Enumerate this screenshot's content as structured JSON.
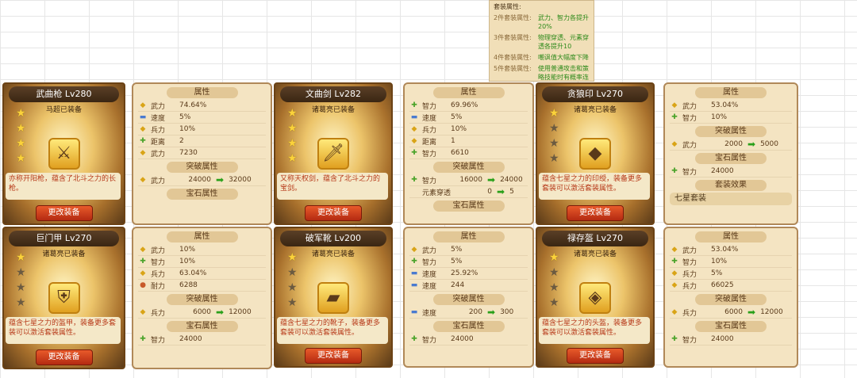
{
  "suit_info": {
    "title": "套装属性:",
    "rows": [
      {
        "key": "2件套装属性:",
        "value": "武力、智力各提升20%"
      },
      {
        "key": "3件套装属性:",
        "value": "物理穿透、元素穿透各提升10"
      },
      {
        "key": "4件套装属性:",
        "value": "嘲讽值大幅度下降"
      },
      {
        "key": "5件套装属性:",
        "value": "使用普通攻击和策略技能时有概率连击"
      }
    ]
  },
  "cards": [
    {
      "title": "武曲枪 Lv280",
      "sub": "马超已装备",
      "stars": [
        1,
        1,
        1,
        1
      ],
      "item_icon": "spear-icon",
      "item_glyph": "⚔",
      "desc": "亦称开阳枪，蕴含了北斗之力的长枪。",
      "button": "更改装备"
    },
    {
      "title": "文曲剑 Lv282",
      "sub": "诸葛亮已装备",
      "stars": [
        1,
        1,
        1,
        1
      ],
      "item_icon": "sword-icon",
      "item_glyph": "🗡",
      "desc": "又称天权剑，蕴含了北斗之力的宝剑。",
      "button": "更改装备"
    },
    {
      "title": "贪狼印 Lv270",
      "sub": "诸葛亮已装备",
      "stars": [
        1,
        0,
        0,
        0
      ],
      "item_icon": "seal-icon",
      "item_glyph": "◆",
      "desc": "蕴含七星之力的印绶，装备更多套装可以激活套装属性。",
      "button": "更改装备"
    },
    {
      "title": "巨门甲 Lv270",
      "sub": "诸葛亮已装备",
      "stars": [
        1,
        0,
        0,
        0
      ],
      "item_icon": "armor-icon",
      "item_glyph": "⛨",
      "desc": "蕴含七星之力的盔甲，装备更多套装可以激活套装属性。",
      "button": "更改装备"
    },
    {
      "title": "破军靴 Lv200",
      "sub": "诸葛亮已装备",
      "stars": [
        1,
        0,
        0,
        0
      ],
      "item_icon": "boots-icon",
      "item_glyph": "▰",
      "desc": "蕴含七星之力的靴子，装备更多套装可以激活套装属性。",
      "button": "更改装备"
    },
    {
      "title": "禄存盔 Lv270",
      "sub": "诸葛亮已装备",
      "stars": [
        1,
        0,
        0,
        0
      ],
      "item_icon": "helmet-icon",
      "item_glyph": "◈",
      "desc": "蕴含七星之力的头盔，装备更多套装可以激活套装属性。",
      "button": "更改装备"
    }
  ],
  "panels": [
    {
      "attr_title": "属性",
      "attrs": [
        {
          "icon": "g",
          "name": "武力",
          "value": "74.64%"
        },
        {
          "icon": "b",
          "name": "速度",
          "value": "5%"
        },
        {
          "icon": "g",
          "name": "兵力",
          "value": "10%"
        },
        {
          "icon": "gr",
          "name": "距离",
          "value": "2"
        },
        {
          "icon": "g",
          "name": "武力",
          "value": "7230"
        }
      ],
      "break_title": "突破属性",
      "breaks": [
        {
          "icon": "g",
          "name": "武力",
          "from": "24000",
          "to": "32000"
        }
      ],
      "gem_title": "宝石属性",
      "gems": []
    },
    {
      "attr_title": "属性",
      "attrs": [
        {
          "icon": "gr",
          "name": "智力",
          "value": "69.96%"
        },
        {
          "icon": "b",
          "name": "速度",
          "value": "5%"
        },
        {
          "icon": "g",
          "name": "兵力",
          "value": "10%"
        },
        {
          "icon": "g",
          "name": "距离",
          "value": "1"
        },
        {
          "icon": "gr",
          "name": "智力",
          "value": "6610"
        }
      ],
      "break_title": "突破属性",
      "breaks": [
        {
          "icon": "gr",
          "name": "智力",
          "from": "16000",
          "to": "24000"
        },
        {
          "icon": "",
          "name": "元素穿透",
          "from": "0",
          "to": "5"
        }
      ],
      "gem_title": "宝石属性",
      "gems": []
    },
    {
      "attr_title": "属性",
      "attrs": [
        {
          "icon": "g",
          "name": "武力",
          "value": "53.04%"
        },
        {
          "icon": "gr",
          "name": "智力",
          "value": "10%"
        }
      ],
      "break_title": "突破属性",
      "breaks": [
        {
          "icon": "g",
          "name": "武力",
          "from": "2000",
          "to": "5000"
        }
      ],
      "gem_title": "宝石属性",
      "gems": [
        {
          "icon": "gr",
          "name": "智力",
          "value": "24000"
        }
      ],
      "effect_title": "套装效果",
      "effect_text": "七星套装"
    },
    {
      "attr_title": "属性",
      "attrs": [
        {
          "icon": "g",
          "name": "武力",
          "value": "10%"
        },
        {
          "icon": "gr",
          "name": "智力",
          "value": "10%"
        },
        {
          "icon": "g",
          "name": "兵力",
          "value": "63.04%"
        },
        {
          "icon": "r",
          "name": "耐力",
          "value": "6288"
        }
      ],
      "break_title": "突破属性",
      "breaks": [
        {
          "icon": "g",
          "name": "兵力",
          "from": "6000",
          "to": "12000"
        }
      ],
      "gem_title": "宝石属性",
      "gems": [
        {
          "icon": "gr",
          "name": "智力",
          "value": "24000"
        }
      ]
    },
    {
      "attr_title": "属性",
      "attrs": [
        {
          "icon": "g",
          "name": "武力",
          "value": "5%"
        },
        {
          "icon": "gr",
          "name": "智力",
          "value": "5%"
        },
        {
          "icon": "b",
          "name": "速度",
          "value": "25.92%"
        },
        {
          "icon": "b",
          "name": "速度",
          "value": "244"
        }
      ],
      "break_title": "突破属性",
      "breaks": [
        {
          "icon": "b",
          "name": "速度",
          "from": "200",
          "to": "300"
        }
      ],
      "gem_title": "宝石属性",
      "gems": [
        {
          "icon": "gr",
          "name": "智力",
          "value": "24000"
        }
      ]
    },
    {
      "attr_title": "属性",
      "attrs": [
        {
          "icon": "g",
          "name": "武力",
          "value": "53.04%"
        },
        {
          "icon": "gr",
          "name": "智力",
          "value": "10%"
        },
        {
          "icon": "g",
          "name": "兵力",
          "value": "5%"
        },
        {
          "icon": "g",
          "name": "兵力",
          "value": "66025"
        }
      ],
      "break_title": "突破属性",
      "breaks": [
        {
          "icon": "g",
          "name": "兵力",
          "from": "6000",
          "to": "12000"
        }
      ],
      "gem_title": "宝石属性",
      "gems": [
        {
          "icon": "gr",
          "name": "智力",
          "value": "24000"
        }
      ]
    }
  ],
  "icons": {
    "g": "◆",
    "b": "▬",
    "gr": "✚",
    "r": "●"
  },
  "arrow": "➡"
}
